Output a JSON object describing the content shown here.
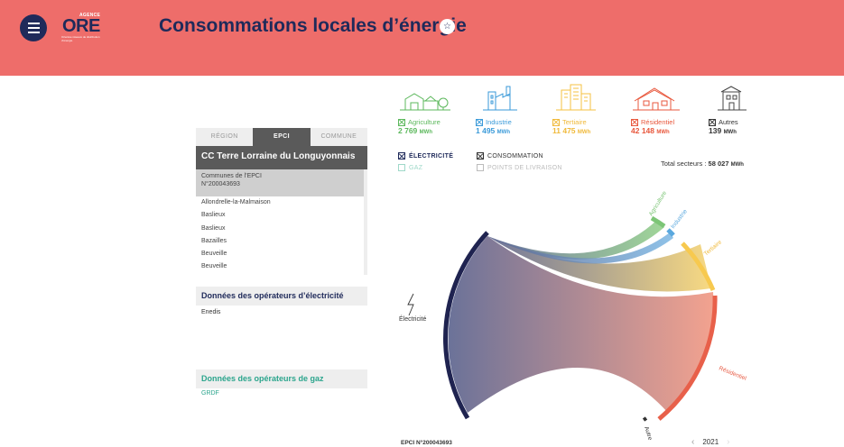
{
  "header": {
    "title": "Consommations locales d’énergie",
    "logo": {
      "top": "AGENCE",
      "main": "ORE",
      "sub": "Orientée réseaux de distribution d’énergie"
    },
    "bg_color": "#ee6d6a"
  },
  "tabs": [
    "RÉGION",
    "EPCI",
    "COMMUNE"
  ],
  "epci": {
    "name": "CC Terre Lorraine du Longuyonnais",
    "list_head": "Communes de l’EPCI",
    "list_code": "N°200043693",
    "communes": [
      "Allondrelle-la-Malmaison",
      "Baslieux",
      "Baslieux",
      "Bazailles",
      "Beuveille",
      "Beuveille"
    ]
  },
  "operators": {
    "electricity_header": "Données des opérateurs d’électricité",
    "electricity_items": [
      "Enedis"
    ],
    "gas_header": "Données des opérateurs de gaz",
    "gas_items": [
      "GRDF"
    ]
  },
  "sectors": [
    {
      "label": "Agriculture",
      "value": "2 769",
      "unit": "MWh",
      "color": "#5cb85c",
      "icon": "farm-icon"
    },
    {
      "label": "Industrie",
      "value": "1 495",
      "unit": "MWh",
      "color": "#3a9ad9",
      "icon": "factory-icon"
    },
    {
      "label": "Tertiaire",
      "value": "11 475",
      "unit": "MWh",
      "color": "#f5c242",
      "icon": "office-icon"
    },
    {
      "label": "Résidentiel",
      "value": "42 148",
      "unit": "MWh",
      "color": "#e8573c",
      "icon": "house-icon"
    },
    {
      "label": "Autres",
      "value": "139",
      "unit": "MWh",
      "color": "#333333",
      "icon": "building-icon"
    }
  ],
  "energies": {
    "electricite": "ÉLECTRICITÉ",
    "gaz": "GAZ",
    "consommation": "CONSOMMATION",
    "points": "POINTS DE LIVRAISON"
  },
  "total": {
    "label": "Total secteurs :",
    "value": "58 027",
    "unit": "MWh"
  },
  "chord": {
    "source_label": "Électricité",
    "targets": [
      "Agriculture",
      "Industrie",
      "Tertiaire",
      "Résidentiel",
      "Autres"
    ],
    "colors": {
      "elec": "#1f2350",
      "agri": "#7cc576",
      "indus": "#5aa8de",
      "tert": "#f7c94f",
      "resid": "#e8604a",
      "autres": "#b8c4d8"
    }
  },
  "footer": {
    "epci_code": "EPCI N°200043693",
    "year": "2021"
  }
}
